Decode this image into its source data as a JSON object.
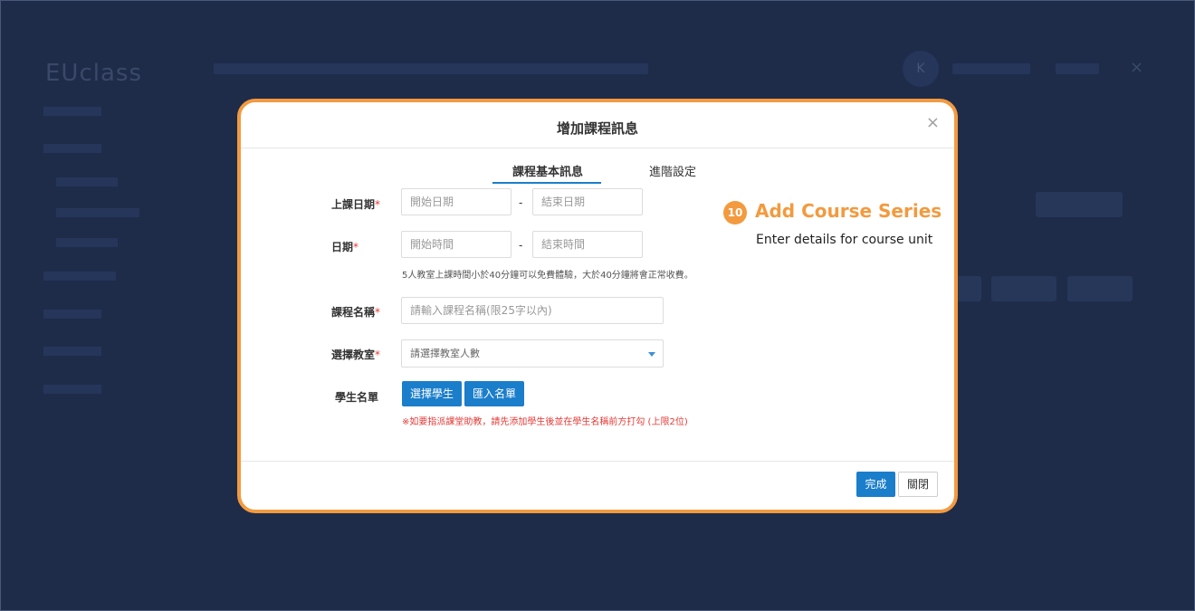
{
  "background_app": {
    "logo_main": "EU",
    "logo_sub": "class",
    "avatar_letter": "K",
    "close_symbol": "×"
  },
  "modal": {
    "title": "增加課程訊息",
    "close_symbol": "×",
    "tabs": [
      {
        "label": "課程基本訊息",
        "active": true
      },
      {
        "label": "進階設定",
        "active": false
      }
    ],
    "fields": {
      "class_date": {
        "label": "上課日期",
        "required_mark": "*",
        "start_placeholder": "開始日期",
        "separator": "-",
        "end_placeholder": "結束日期"
      },
      "time": {
        "label": "日期",
        "required_mark": "*",
        "start_placeholder": "開始時間",
        "separator": "-",
        "end_placeholder": "結束時間",
        "hint": "5人教室上課時間小於40分鐘可以免費體驗，大於40分鐘將會正常收費。"
      },
      "course_name": {
        "label": "課程名稱",
        "required_mark": "*",
        "placeholder": "請輸入課程名稱(限25字以內)"
      },
      "classroom": {
        "label": "選擇教室",
        "required_mark": "*",
        "selected_value": "請選擇教室人數"
      },
      "students": {
        "label": "學生名單",
        "select_button": "選擇學生",
        "import_button": "匯入名單",
        "warning": "※如要指派課堂助教，請先添加學生後並在學生名稱前方打勾 (上限2位)"
      }
    },
    "footer": {
      "done_button": "完成",
      "close_button": "關閉"
    }
  },
  "annotation": {
    "step_number": "10",
    "title": "Add Course Series",
    "description": "Enter details for course unit"
  },
  "colors": {
    "page_background": "#1e2c4a",
    "highlight_border": "#f39a3f",
    "primary_button": "#1b7ecb",
    "required_mark": "#e53935"
  }
}
